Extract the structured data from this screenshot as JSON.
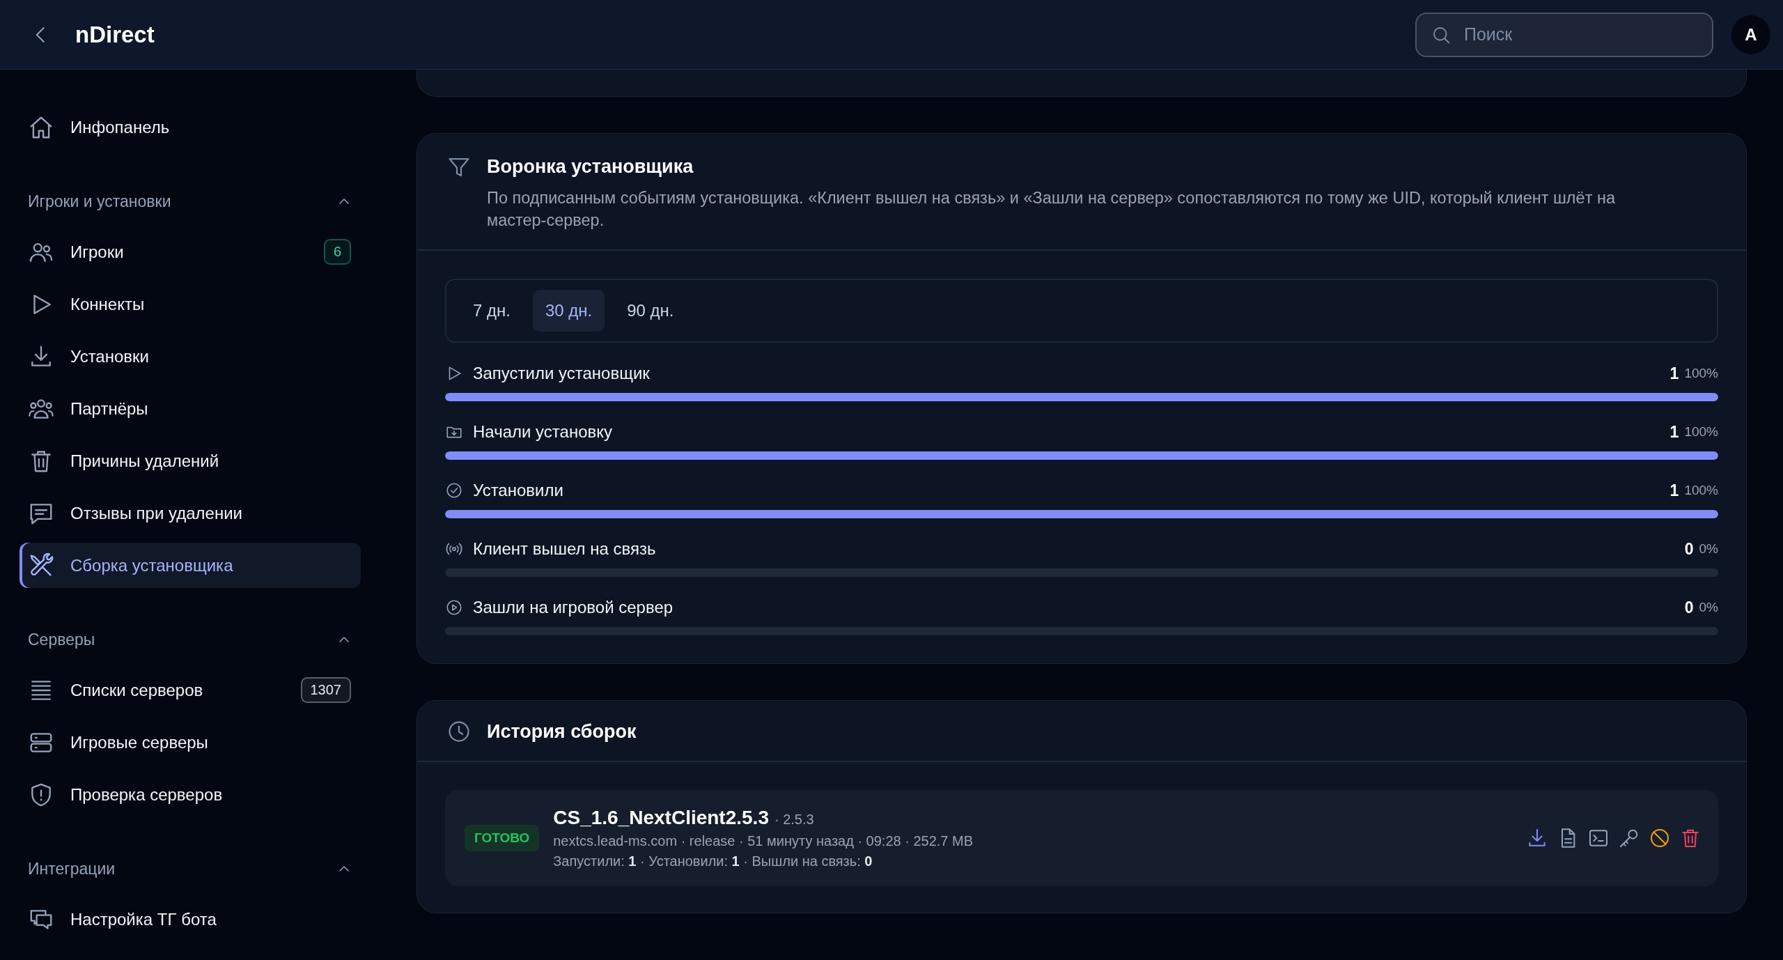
{
  "header": {
    "title": "nDirect",
    "search": {
      "placeholder": "Поиск"
    },
    "avatar": "A"
  },
  "sidebar": {
    "items": [
      {
        "label": "Инфопанель",
        "selected": false
      }
    ],
    "sections": [
      {
        "title": "Игроки и установки",
        "expanded": true,
        "items": [
          {
            "label": "Игроки",
            "selected": false,
            "badge": {
              "text": "6",
              "color": "#34d399"
            }
          },
          {
            "label": "Коннекты",
            "selected": false
          },
          {
            "label": "Установки",
            "selected": false
          },
          {
            "label": "Партнёры",
            "selected": false
          },
          {
            "label": "Причины удалений",
            "selected": false
          },
          {
            "label": "Отзывы при удалении",
            "selected": false
          },
          {
            "label": "Сборка установщика",
            "selected": true
          }
        ]
      },
      {
        "title": "Серверы",
        "expanded": true,
        "items": [
          {
            "label": "Списки серверов",
            "selected": false,
            "badge": {
              "text": "1307",
              "color": "#e5e7eb"
            }
          },
          {
            "label": "Игровые серверы",
            "selected": false
          },
          {
            "label": "Проверка серверов",
            "selected": false
          }
        ]
      },
      {
        "title": "Интеграции",
        "expanded": true,
        "items": [
          {
            "label": "Настройка ТГ бота",
            "selected": false
          }
        ]
      }
    ]
  },
  "funnel": {
    "title": "Воронка установщика",
    "description": "По подписанным событиям установщика. «Клиент вышел на связь» и «Зашли на сервер» сопоставляются по тому же UID, который клиент шлёт на мастер-сервер.",
    "periods": [
      {
        "label": "7 дн.",
        "selected": false
      },
      {
        "label": "30 дн.",
        "selected": true
      },
      {
        "label": "90 дн.",
        "selected": false
      }
    ],
    "steps": [
      {
        "label": "Запустили установщик",
        "count": "1",
        "percent": "100%",
        "level": 1
      },
      {
        "label": "Начали установку",
        "count": "1",
        "percent": "100%",
        "level": 1
      },
      {
        "label": "Установили",
        "count": "1",
        "percent": "100%",
        "level": 1
      },
      {
        "label": "Клиент вышел на связь",
        "count": "0",
        "percent": "0%",
        "level": 0
      },
      {
        "label": "Зашли на игровой сервер",
        "count": "0",
        "percent": "0%",
        "level": 0
      }
    ]
  },
  "history": {
    "title": "История сборок",
    "builds": [
      {
        "status": "ГОТОВО",
        "name": "CS_1.6_NextClient2.5.3",
        "version": "· 2.5.3",
        "meta": "nextcs.lead-ms.com · release · 51 минуту назад · 09:28 · 252.7 MB",
        "stats": "Запустили: **1** · Установили: **1** · Вышли на связь: **0**"
      }
    ]
  }
}
